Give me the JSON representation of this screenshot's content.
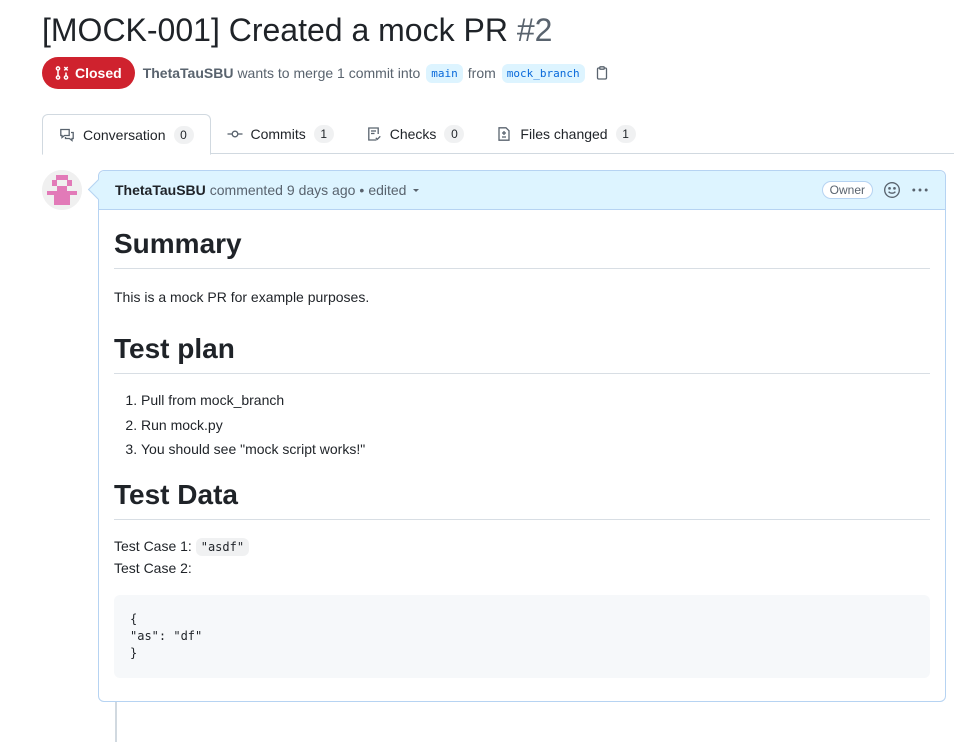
{
  "pr": {
    "title": "[MOCK-001] Created a mock PR",
    "number": "#2",
    "state": "Closed",
    "author": "ThetaTauSBU",
    "merge_text": "wants to merge 1 commit into",
    "base_branch": "main",
    "from_text": "from",
    "head_branch": "mock_branch"
  },
  "tabs": [
    {
      "label": "Conversation",
      "count": "0",
      "icon": "comment-discussion-icon"
    },
    {
      "label": "Commits",
      "count": "1",
      "icon": "git-commit-icon"
    },
    {
      "label": "Checks",
      "count": "0",
      "icon": "checklist-icon"
    },
    {
      "label": "Files changed",
      "count": "1",
      "icon": "file-diff-icon"
    }
  ],
  "comment": {
    "author": "ThetaTauSBU",
    "action": "commented",
    "time": "9 days ago",
    "separator": "•",
    "edited": "edited",
    "role_badge": "Owner",
    "summary_heading": "Summary",
    "summary_text": "This is a mock PR for example purposes.",
    "test_plan_heading": "Test plan",
    "steps": [
      "Pull from mock_branch",
      "Run mock.py",
      "You should see \"mock script works!\""
    ],
    "test_data_heading": "Test Data",
    "case1_label": "Test Case 1:",
    "case1_code": "\"asdf\"",
    "case2_label": "Test Case 2:",
    "code_block": "{\n\"as\": \"df\"\n}"
  },
  "colors": {
    "closed": "#cf222e",
    "accent": "#0969da",
    "header_bg": "#ddf4ff",
    "avatar": "#e27ab8"
  }
}
